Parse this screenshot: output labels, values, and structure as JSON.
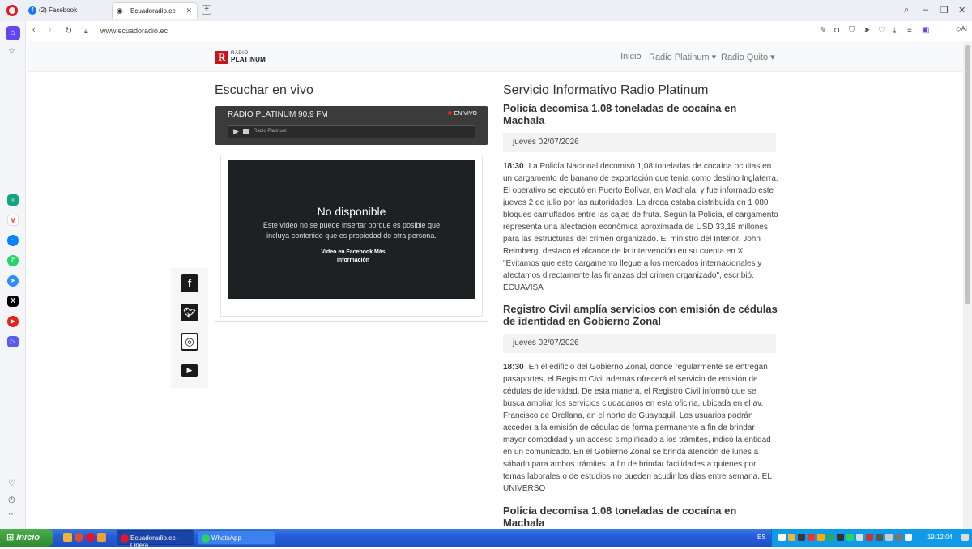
{
  "browser": {
    "tabs": [
      {
        "label": "(2) Facebook"
      },
      {
        "label": "Ecuadoradio.ec"
      }
    ],
    "url": "www.ecuadoradio.ec",
    "ai_label": "AI"
  },
  "site": {
    "logo": {
      "line1": "RADIO",
      "line2": "PLATINUM",
      "mark": "R"
    },
    "menu": [
      "Inicio",
      "Radio Platinum ▾",
      "Radio Quito ▾"
    ]
  },
  "live": {
    "heading": "Escuchar en vivo",
    "station": "RADIO PLATINUM 90.9 FM",
    "live_badge": "EN VIVO",
    "player_name": "Radio Platinum",
    "video": {
      "title": "No disponible",
      "message": "Este vídeo no se puede insertar porque es posible que incluya contenido que es propiedad de otra persona.",
      "links": "Vídeo en Facebook   Más información"
    }
  },
  "social": [
    "facebook-icon",
    "twitter-icon",
    "instagram-icon",
    "youtube-icon"
  ],
  "news": {
    "heading": "Servicio Informativo Radio Platinum",
    "articles": [
      {
        "title": "Policía decomisa 1,08 toneladas de cocaína en Machala",
        "date": "jueves 02/07/2026",
        "time": "18:30",
        "body": "La Policía Nacional decomisó 1,08 toneladas de cocaína ocultas en un cargamento de banano de exportación que tenía como destino Inglaterra. El operativo se ejecutó en Puerto Bolívar, en Machala, y fue informado este jueves 2 de julio por las autoridades. La droga estaba distribuida en 1 080 bloques camuflados entre las cajas de fruta. Según la Policía, el cargamento representa una afectación económica aproximada de USD 33,18 millones para las estructuras del crimen organizado. El ministro del Interior, John Reimberg, destacó el alcance de la intervención en su cuenta en X. \"Evitamos que este cargamento llegue a los mercados internacionales y afectamos directamente las finanzas del crimen organizado\", escribió. ECUAVISA"
      },
      {
        "title": "Registro Civil amplía servicios con emisión de cédulas de identidad en Gobierno Zonal",
        "date": "jueves 02/07/2026",
        "time": "18:30",
        "body": "En el edificio del Gobierno Zonal, donde regularmente se entregan pasaportes, el Registro Civil además ofrecerá el servicio de emisión de cédulas de identidad. De esta manera, el Registro Civil informó que se busca ampliar los servicios ciudadanos en esta oficina, ubicada en el av. Francisco de Orellana, en el norte de Guayaquil. Los usuarios podrán acceder a la emisión de cédulas de forma permanente a fin de brindar mayor comodidad y un acceso simplificado a los trámites, indicó la entidad en un comunicado. En el Gobierno Zonal se brinda atención de lunes a sábado para ambos trámites, a fin de brindar facilidades a quienes por temas laborales o de estudios no pueden acudir los días entre semana. EL UNIVERSO"
      },
      {
        "title": "Policía decomisa 1,08 toneladas de cocaína en Machala"
      }
    ]
  },
  "taskbar": {
    "start": "Inicio",
    "tasks": [
      "Ecuadoradio.ec - Opera",
      "WhatsApp"
    ],
    "lang": "ES",
    "clock": "19:12:04"
  }
}
